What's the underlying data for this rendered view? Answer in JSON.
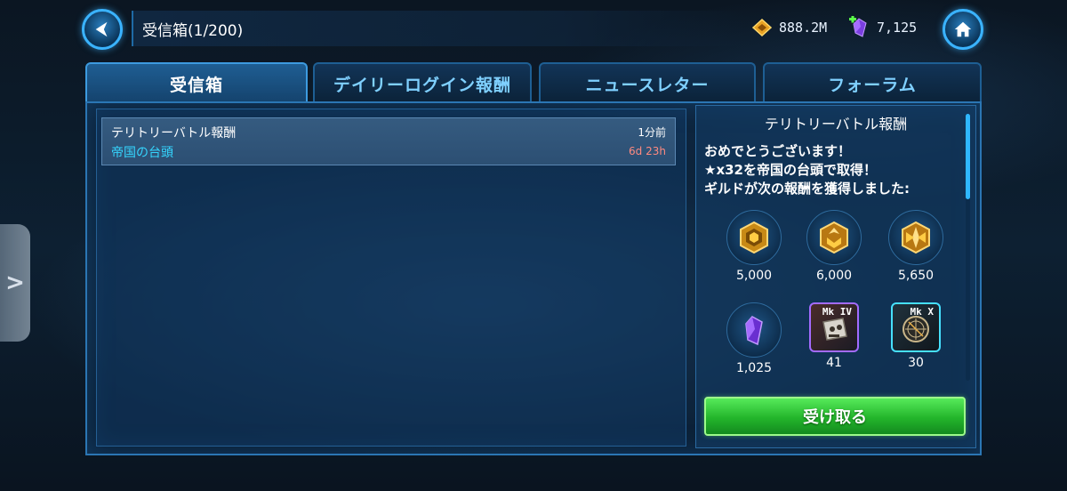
{
  "header": {
    "title": "受信箱(1/200)",
    "gold_amount": "888.2M",
    "gem_amount": "7,125"
  },
  "tabs": [
    {
      "label": "受信箱",
      "active": true
    },
    {
      "label": "デイリーログイン報酬",
      "active": false
    },
    {
      "label": "ニュースレター",
      "active": false
    },
    {
      "label": "フォーラム",
      "active": false
    }
  ],
  "mail_list": [
    {
      "title": "テリトリーバトル報酬",
      "subtitle": "帝国の台頭",
      "time": "1分前",
      "expiry": "6d 23h"
    }
  ],
  "detail": {
    "title": "テリトリーバトル報酬",
    "lines": [
      "おめでとうございます！",
      "★x32を帝国の台頭で取得！",
      "ギルドが次の報酬を獲得しました:"
    ],
    "rewards": [
      {
        "icon": "guild-token-icon",
        "amount": "5,000"
      },
      {
        "icon": "guild-event-token-icon",
        "amount": "6,000"
      },
      {
        "icon": "guild-event-token-mk2-icon",
        "amount": "5,650"
      },
      {
        "icon": "crystal-icon",
        "amount": "1,025"
      },
      {
        "icon": "gear-mk-iv-icon",
        "label": "Mk IV",
        "amount": "41"
      },
      {
        "icon": "gear-mk-x-icon",
        "label": "Mk X",
        "amount": "30"
      }
    ],
    "claim_label": "受け取る"
  },
  "side_handle": ">",
  "colors": {
    "accent": "#2fb7ff",
    "claim_green": "#23b52b",
    "expiry_red": "#ff8a80",
    "subtitle_cyan": "#35d6ff"
  }
}
